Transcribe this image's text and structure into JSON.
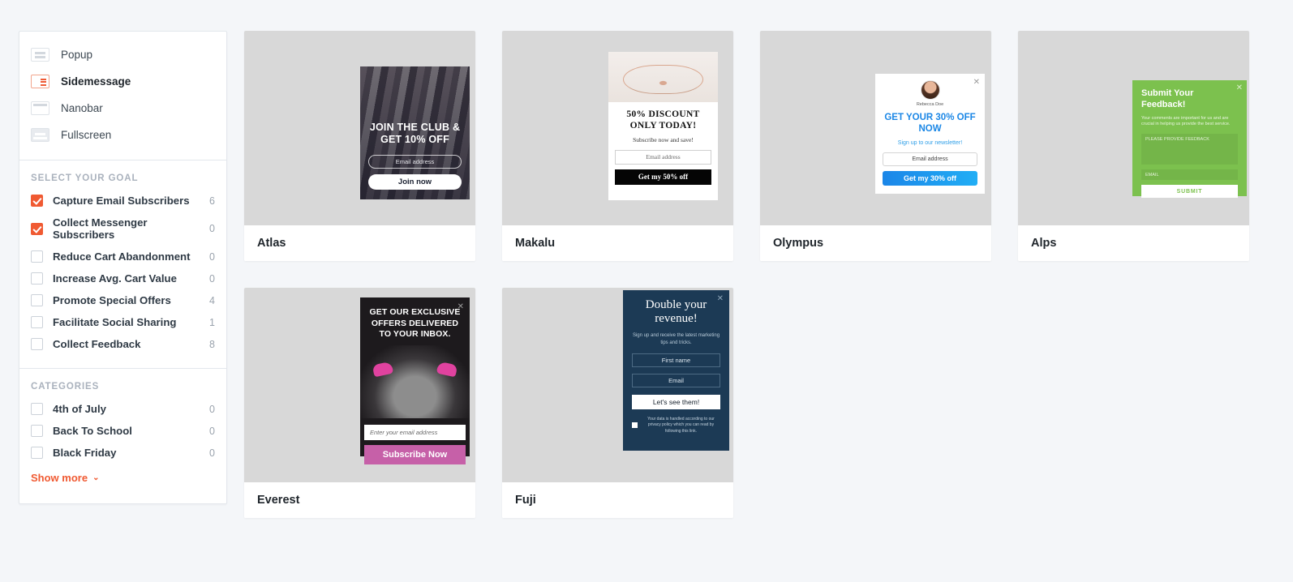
{
  "sidebar": {
    "types": [
      {
        "label": "Popup",
        "icon": "popup-icon",
        "active": false
      },
      {
        "label": "Sidemessage",
        "icon": "sidemessage-icon",
        "active": true
      },
      {
        "label": "Nanobar",
        "icon": "nanobar-icon",
        "active": false
      },
      {
        "label": "Fullscreen",
        "icon": "fullscreen-icon",
        "active": false
      }
    ],
    "goal_section_title": "SELECT YOUR GOAL",
    "goals": [
      {
        "label": "Capture Email Subscribers",
        "count": "6",
        "checked": true
      },
      {
        "label": "Collect Messenger Subscribers",
        "count": "0",
        "checked": true
      },
      {
        "label": "Reduce Cart Abandonment",
        "count": "0",
        "checked": false
      },
      {
        "label": "Increase Avg. Cart Value",
        "count": "0",
        "checked": false
      },
      {
        "label": "Promote Special Offers",
        "count": "4",
        "checked": false
      },
      {
        "label": "Facilitate Social Sharing",
        "count": "1",
        "checked": false
      },
      {
        "label": "Collect Feedback",
        "count": "8",
        "checked": false
      }
    ],
    "categories_section_title": "CATEGORIES",
    "categories": [
      {
        "label": "4th of July",
        "count": "0",
        "checked": false
      },
      {
        "label": "Back To School",
        "count": "0",
        "checked": false
      },
      {
        "label": "Black Friday",
        "count": "0",
        "checked": false
      }
    ],
    "show_more_label": "Show more",
    "chevron": "⌄"
  },
  "accent_color": "#f05a32",
  "templates": [
    {
      "name": "Atlas",
      "heading": "JOIN THE CLUB & GET 10% OFF",
      "input_placeholder": "Email address",
      "button_label": "Join now"
    },
    {
      "name": "Makalu",
      "heading": "50% DISCOUNT ONLY TODAY!",
      "subheading": "Subscribe now and save!",
      "input_placeholder": "Email address",
      "button_label": "Get my 50% off",
      "close": "✕"
    },
    {
      "name": "Olympus",
      "avatar_name": "Rebecca Doe",
      "heading": "GET YOUR 30% OFF NOW",
      "subheading": "Sign up to our newsletter!",
      "input_placeholder": "Email address",
      "button_label": "Get my 30% off",
      "close": "✕"
    },
    {
      "name": "Alps",
      "heading": "Submit Your Feedback!",
      "subheading": "Your comments are important for us and are crucial in helping us provide the best service.",
      "textarea_placeholder": "PLEASE PROVIDE FEEDBACK",
      "input_placeholder": "EMAIL",
      "button_label": "SUBMIT",
      "close": "✕"
    },
    {
      "name": "Everest",
      "heading": "GET OUR EXCLUSIVE OFFERS DELIVERED TO YOUR INBOX.",
      "input_placeholder": "Enter your email address",
      "button_label": "Subscribe Now",
      "close": "✕"
    },
    {
      "name": "Fuji",
      "heading": "Double your revenue!",
      "subheading": "Sign up and receive the latest marketing tips and tricks.",
      "input_placeholder_name": "First name",
      "input_placeholder_email": "Email",
      "button_label": "Let's see them!",
      "legal": "Your data is handled according to our privacy policy which you can read by following this link.",
      "close": "✕"
    }
  ]
}
